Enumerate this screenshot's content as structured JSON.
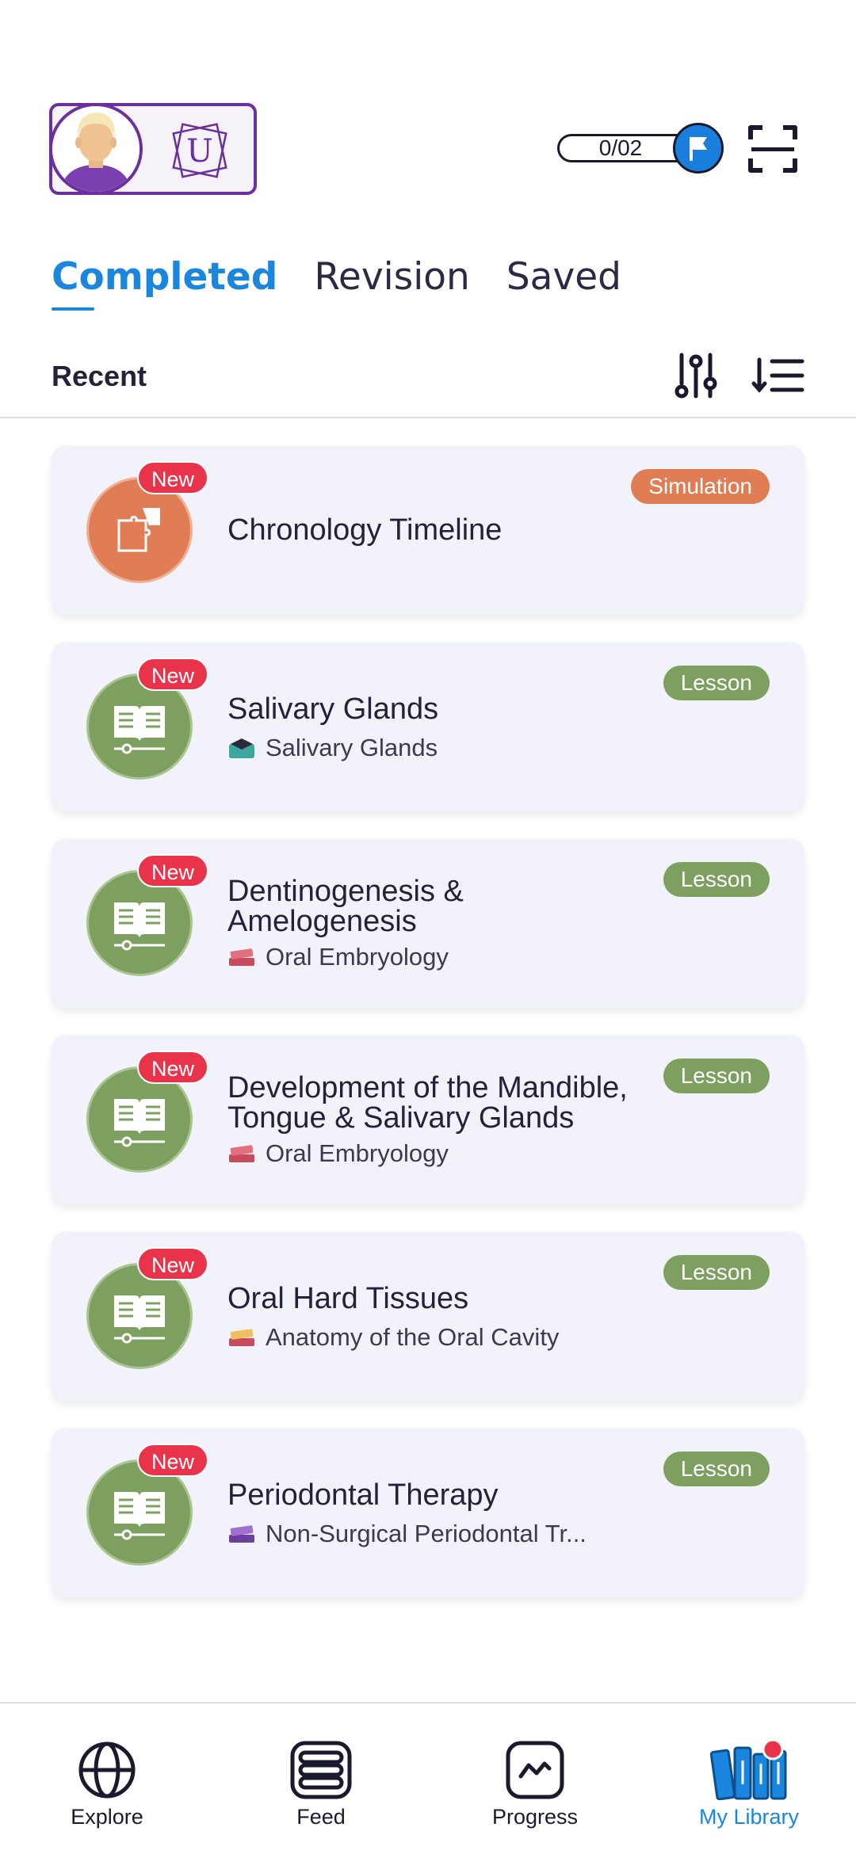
{
  "header": {
    "streak_value": "0/02",
    "avatar_icon": "avatar-icon",
    "logo_letter": "U",
    "flag_icon": "flag-icon",
    "scan_icon": "scan-icon"
  },
  "tabs": [
    {
      "label": "Completed",
      "active": true
    },
    {
      "label": "Revision",
      "active": false
    },
    {
      "label": "Saved",
      "active": false
    }
  ],
  "section": {
    "title": "Recent",
    "filter_icon": "filter-sliders-icon",
    "sort_icon": "sort-icon"
  },
  "cards": [
    {
      "badge": "New",
      "type": "Simulation",
      "title": "Chronology Timeline",
      "subtitle": "",
      "icon": "puzzle-icon"
    },
    {
      "badge": "New",
      "type": "Lesson",
      "title": "Salivary Glands",
      "subtitle": "Salivary Glands",
      "icon": "book-icon"
    },
    {
      "badge": "New",
      "type": "Lesson",
      "title": "Dentinogenesis & Amelogenesis",
      "subtitle": "Oral Embryology",
      "icon": "book-icon"
    },
    {
      "badge": "New",
      "type": "Lesson",
      "title": "Development of the Mandible, Tongue & Salivary Glands",
      "subtitle": "Oral Embryology",
      "icon": "book-icon"
    },
    {
      "badge": "New",
      "type": "Lesson",
      "title": "Oral Hard Tissues",
      "subtitle": "Anatomy of the Oral Cavity",
      "icon": "book-icon"
    },
    {
      "badge": "New",
      "type": "Lesson",
      "title": "Periodontal Therapy",
      "subtitle": "Non-Surgical Periodontal Tr...",
      "icon": "book-icon"
    }
  ],
  "nav": [
    {
      "label": "Explore",
      "icon": "globe-icon"
    },
    {
      "label": "Feed",
      "icon": "feed-icon"
    },
    {
      "label": "Progress",
      "icon": "progress-chart-icon"
    },
    {
      "label": "My Library",
      "icon": "library-icon",
      "active": true
    }
  ],
  "colors": {
    "accent": "#1a86dd",
    "simulation": "#e07d55",
    "lesson": "#7da060",
    "new_badge": "#e8334b",
    "profile_border": "#6b2fa0"
  }
}
